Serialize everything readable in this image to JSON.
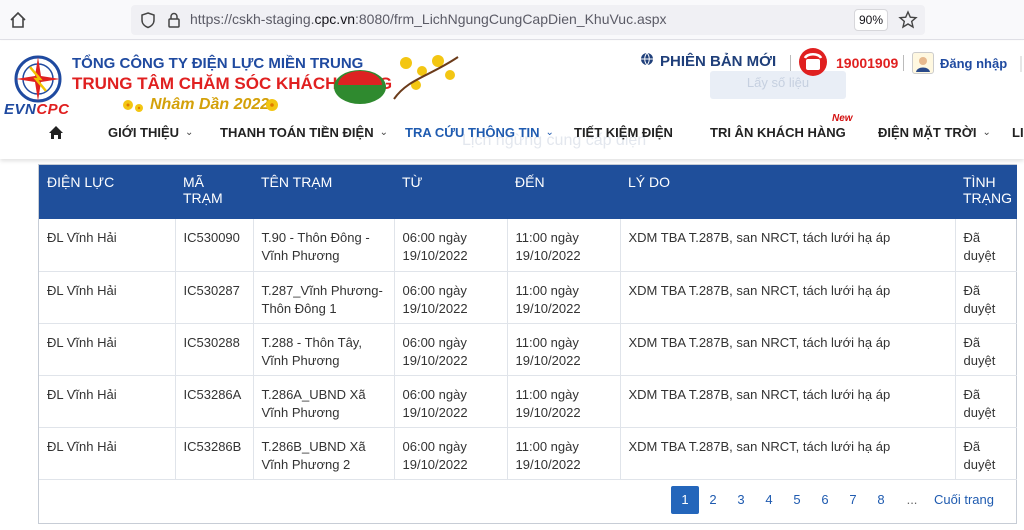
{
  "browser": {
    "url_prefix": "https://cskh-staging.",
    "url_domain": "cpc.vn",
    "url_suffix": ":8080/frm_LichNgungCungCapDien_KhuVuc.aspx",
    "zoom": "90%"
  },
  "header": {
    "logo_brand_left": "EVN",
    "logo_brand_right": "CPC",
    "company_name": "TỔNG CÔNG TY ĐIỆN LỰC MIỀN TRUNG",
    "center_name": "TRUNG TÂM CHĂM SÓC KHÁCH HÀNG",
    "year_text": "Nhâm Dần 2022",
    "new_version": "PHIÊN BẢN MỚI",
    "hotline": "19001909",
    "login": "Đăng nhập",
    "ghost_button": "Lấy số liệu",
    "ghost_subtitle": "Lịch ngừng cung cấp điện"
  },
  "nav": {
    "items": [
      {
        "label": "GIỚI THIỆU"
      },
      {
        "label": "THANH TOÁN TIỀN ĐIỆN"
      },
      {
        "label": "TRA CỨU THÔNG TIN"
      },
      {
        "label": "TIẾT KIỆM ĐIỆN"
      },
      {
        "label": "TRI ÂN KHÁCH HÀNG"
      },
      {
        "label": "ĐIỆN MẶT TRỜI"
      },
      {
        "label": "LI"
      }
    ],
    "new_badge": "New"
  },
  "table": {
    "headers": [
      "ĐIỆN LỰC",
      "MÃ TRẠM",
      "TÊN TRẠM",
      "TỪ",
      "ĐẾN",
      "LÝ DO",
      "TÌNH TRẠNG"
    ],
    "rows": [
      {
        "dienluc": "ĐL Vĩnh Hải",
        "ma": "IC530090",
        "ten": "T.90 - Thôn Đông - Vĩnh Phương",
        "tu": "06:00 ngày 19/10/2022",
        "den": "11:00 ngày 19/10/2022",
        "lydo": "XDM TBA T.287B, san NRCT, tách lưới hạ áp",
        "tinhtrang": "Đã duyệt"
      },
      {
        "dienluc": "ĐL Vĩnh Hải",
        "ma": "IC530287",
        "ten": "T.287_Vĩnh Phương-Thôn Đông 1",
        "tu": "06:00 ngày 19/10/2022",
        "den": "11:00 ngày 19/10/2022",
        "lydo": "XDM TBA T.287B, san NRCT, tách lưới hạ áp",
        "tinhtrang": "Đã duyệt"
      },
      {
        "dienluc": "ĐL Vĩnh Hải",
        "ma": "IC530288",
        "ten": "T.288 - Thôn Tây, Vĩnh Phương",
        "tu": "06:00 ngày 19/10/2022",
        "den": "11:00 ngày 19/10/2022",
        "lydo": "XDM TBA T.287B, san NRCT, tách lưới hạ áp",
        "tinhtrang": "Đã duyệt"
      },
      {
        "dienluc": "ĐL Vĩnh Hải",
        "ma": "IC53286A",
        "ten": "T.286A_UBND Xã Vĩnh Phương",
        "tu": "06:00 ngày 19/10/2022",
        "den": "11:00 ngày 19/10/2022",
        "lydo": "XDM TBA T.287B, san NRCT, tách lưới hạ áp",
        "tinhtrang": "Đã duyệt"
      },
      {
        "dienluc": "ĐL Vĩnh Hải",
        "ma": "IC53286B",
        "ten": "T.286B_UBND Xã Vĩnh Phương 2",
        "tu": "06:00 ngày 19/10/2022",
        "den": "11:00 ngày 19/10/2022",
        "lydo": "XDM TBA T.287B, san NRCT, tách lưới hạ áp",
        "tinhtrang": "Đã duyệt"
      }
    ]
  },
  "pager": {
    "pages": [
      "1",
      "2",
      "3",
      "4",
      "5",
      "6",
      "7",
      "8"
    ],
    "current": "1",
    "ellipsis": "...",
    "last": "Cuối trang"
  },
  "colors": {
    "header_blue": "#1f4f9b",
    "brand_red": "#e02020",
    "brand_blue": "#1f4aa0"
  }
}
